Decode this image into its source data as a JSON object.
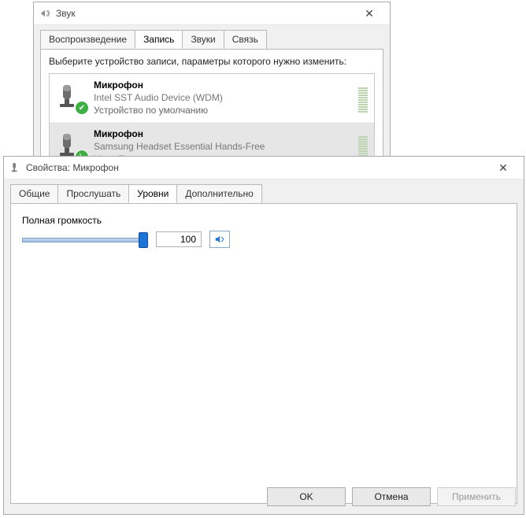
{
  "sound": {
    "title": "Звук",
    "tabs": [
      "Воспроизведение",
      "Запись",
      "Звуки",
      "Связь"
    ],
    "active_tab": 1,
    "instruction": "Выберите устройство записи, параметры которого нужно изменить:",
    "devices": [
      {
        "name": "Микрофон",
        "driver": "Intel SST Audio Device (WDM)",
        "role": "Устройство по умолчанию",
        "status_kind": "ok"
      },
      {
        "name": "Микрофон",
        "driver": "Samsung Headset Essential Hands-Free",
        "role": "Устройство связи по умолчанию",
        "status_kind": "call",
        "selected": true
      }
    ]
  },
  "props": {
    "title": "Свойства: Микрофон",
    "tabs": [
      "Общие",
      "Прослушать",
      "Уровни",
      "Дополнительно"
    ],
    "active_tab": 2,
    "volume": {
      "label": "Полная громкость",
      "value": 100,
      "max": 100
    },
    "buttons": {
      "ok": "OK",
      "cancel": "Отмена",
      "apply": "Применить"
    }
  }
}
